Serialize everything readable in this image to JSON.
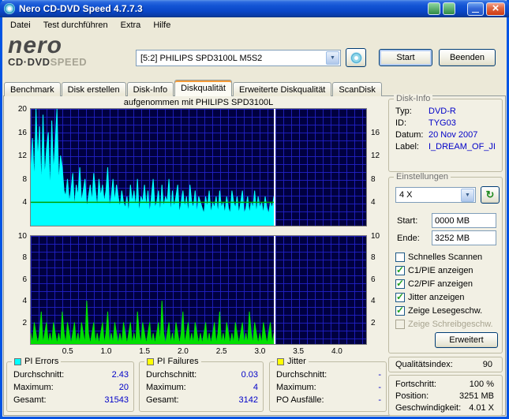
{
  "window": {
    "title": "Nero CD-DVD Speed 4.7.7.3"
  },
  "menu": {
    "items": [
      "Datei",
      "Test durchführen",
      "Extra",
      "Hilfe"
    ]
  },
  "logo": {
    "brand": "nero",
    "product_solid": "CD·DVD",
    "product_outline": "SPEED"
  },
  "drive_selector": {
    "value": "[5:2]  PHILIPS SPD3100L M5S2"
  },
  "buttons": {
    "start": "Start",
    "quit": "Beenden"
  },
  "tabs": [
    {
      "label": "Benchmark",
      "active": false
    },
    {
      "label": "Disk erstellen",
      "active": false
    },
    {
      "label": "Disk-Info",
      "active": false
    },
    {
      "label": "Diskqualität",
      "active": true
    },
    {
      "label": "Erweiterte Diskqualität",
      "active": false
    },
    {
      "label": "ScanDisk",
      "active": false
    }
  ],
  "chart": {
    "title": "aufgenommen mit PHILIPS  SPD3100L"
  },
  "chart_data": [
    {
      "type": "area",
      "series": "PI Errors",
      "color": "#00FFFF",
      "bg": "#000040",
      "grid_color": "#2222CC",
      "cursor_color": "#FFFFFF",
      "x_max_gb": 4.38,
      "x_end_gb": 3.175,
      "ylim": [
        0,
        20
      ],
      "y_ticks_left": [
        20,
        16,
        12,
        8,
        4
      ],
      "y_ticks_right": [
        16,
        12,
        8,
        4
      ],
      "speed_line": {
        "value": 4,
        "color": "#00A000",
        "name": "read-speed-4x"
      },
      "values": [
        9,
        15,
        7,
        20,
        11,
        17,
        6,
        19,
        8,
        13,
        16,
        5,
        18,
        9,
        14,
        20,
        7,
        12,
        10,
        6,
        5,
        8,
        4,
        6,
        9,
        3,
        7,
        5,
        10,
        4,
        6,
        8,
        3,
        5,
        7,
        4,
        9,
        6,
        3,
        8,
        5,
        7,
        4,
        6,
        10,
        3,
        5,
        8,
        4,
        7,
        5,
        3,
        6,
        4,
        3,
        5,
        2,
        7,
        4,
        6,
        3,
        8,
        2,
        5,
        4,
        7,
        3,
        6,
        2,
        5,
        8,
        3,
        4,
        6,
        2,
        7,
        3,
        5,
        4,
        8,
        2,
        6,
        3,
        5,
        7,
        2,
        4,
        6,
        3,
        5,
        2,
        7,
        4,
        3,
        6,
        2,
        5,
        4,
        3,
        2,
        5,
        3,
        6,
        2,
        4,
        3,
        5,
        2,
        6,
        3,
        4,
        2,
        5,
        3,
        2,
        6,
        4,
        3,
        5,
        2,
        4,
        6,
        2,
        3,
        5,
        2,
        4,
        3,
        6,
        2,
        5,
        3,
        4,
        2,
        5,
        3,
        2,
        4,
        3,
        5
      ]
    },
    {
      "type": "area",
      "series": "PI Failures",
      "color": "#00E000",
      "bg": "#000040",
      "grid_color": "#2222CC",
      "cursor_color": "#FFFFFF",
      "x_max_gb": 4.38,
      "x_end_gb": 3.175,
      "ylim": [
        0,
        10
      ],
      "y_ticks_left": [
        10,
        8,
        6,
        4,
        2
      ],
      "y_ticks_right": [
        10,
        8,
        6,
        4,
        2
      ],
      "x_ticks": [
        "0.5",
        "1.0",
        "1.5",
        "2.0",
        "2.5",
        "3.0",
        "3.5",
        "4.0"
      ],
      "values": [
        1,
        0,
        2,
        1,
        0,
        1,
        3,
        0,
        1,
        2,
        0,
        1,
        0,
        2,
        1,
        0,
        1,
        0,
        3,
        1,
        0,
        2,
        1,
        0,
        1,
        2,
        0,
        1,
        0,
        2,
        1,
        0,
        4,
        1,
        0,
        1,
        2,
        0,
        1,
        0,
        1,
        2,
        0,
        1,
        3,
        0,
        1,
        0,
        2,
        1,
        0,
        1,
        0,
        2,
        1,
        0,
        1,
        2,
        0,
        1,
        0,
        3,
        1,
        0,
        2,
        1,
        0,
        1,
        2,
        0,
        1,
        0,
        1,
        2,
        0,
        4,
        1,
        0,
        1,
        2,
        0,
        1,
        0,
        2,
        1,
        0,
        1,
        3,
        0,
        1,
        2,
        0,
        1,
        0,
        2,
        1,
        0,
        1,
        0,
        1,
        2,
        0,
        1,
        0,
        1,
        2,
        0,
        1,
        3,
        0,
        1,
        0,
        2,
        1,
        0,
        1,
        0,
        2,
        1,
        0,
        1,
        2,
        0,
        1,
        0,
        3,
        1,
        0,
        2,
        1,
        0,
        1,
        0,
        2,
        1,
        0,
        1,
        2,
        0,
        1
      ]
    }
  ],
  "disk_info": {
    "title": "Disk-Info",
    "rows": [
      {
        "label": "Typ:",
        "value": "DVD-R"
      },
      {
        "label": "ID:",
        "value": "TYG03"
      },
      {
        "label": "Datum:",
        "value": "20 Nov 2007"
      },
      {
        "label": "Label:",
        "value": "I_DREAM_OF_JI"
      }
    ]
  },
  "settings": {
    "title": "Einstellungen",
    "speed_value": "4 X",
    "start_label": "Start:",
    "start_value": "0000 MB",
    "end_label": "Ende:",
    "end_value": "3252 MB",
    "checkboxes": [
      {
        "label": "Schnelles Scannen",
        "checked": false,
        "disabled": false
      },
      {
        "label": "C1/PIE anzeigen",
        "checked": true,
        "disabled": false
      },
      {
        "label": "C2/PIF anzeigen",
        "checked": true,
        "disabled": false
      },
      {
        "label": "Jitter anzeigen",
        "checked": true,
        "disabled": false
      },
      {
        "label": "Zeige Lesegeschw.",
        "checked": true,
        "disabled": false
      },
      {
        "label": "Zeige Schreibgeschw.",
        "checked": false,
        "disabled": true
      }
    ],
    "advanced_label": "Erweitert"
  },
  "quality_index": {
    "label": "Qualitätsindex:",
    "value": "90"
  },
  "progress": {
    "rows": [
      {
        "label": "Fortschritt:",
        "value": "100 %"
      },
      {
        "label": "Position:",
        "value": "3251 MB"
      },
      {
        "label": "Geschwindigkeit:",
        "value": "4.01 X"
      }
    ]
  },
  "stats_groups": [
    {
      "title": "PI Errors",
      "swatch": "#00FFFF",
      "rows": [
        {
          "label": "Durchschnitt:",
          "value": "2.43"
        },
        {
          "label": "Maximum:",
          "value": "20"
        },
        {
          "label": "Gesamt:",
          "value": "31543"
        }
      ]
    },
    {
      "title": "PI Failures",
      "swatch": "#FFFF00",
      "rows": [
        {
          "label": "Durchschnitt:",
          "value": "0.03"
        },
        {
          "label": "Maximum:",
          "value": "4"
        },
        {
          "label": "Gesamt:",
          "value": "3142"
        }
      ]
    },
    {
      "title": "Jitter",
      "swatch": "#FFFF00",
      "rows": [
        {
          "label": "Durchschnitt:",
          "value": "-"
        },
        {
          "label": "Maximum:",
          "value": "-"
        },
        {
          "label": "PO Ausfälle:",
          "value": "-"
        }
      ]
    }
  ]
}
